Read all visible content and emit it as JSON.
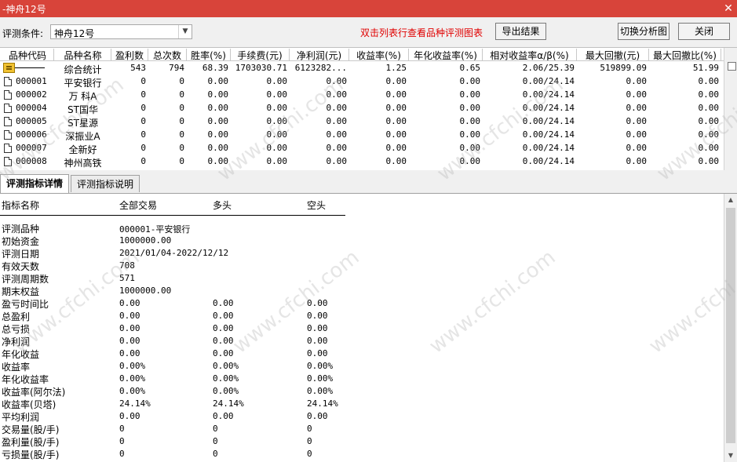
{
  "window": {
    "title": "-神舟12号",
    "close_glyph": "✕"
  },
  "toolbar": {
    "criteria_label": "评测条件:",
    "criteria_value": "神舟12号",
    "hint": "双击列表行查看品种评测图表",
    "export_label": "导出结果",
    "switch_label": "切换分析图",
    "close_label": "关闭"
  },
  "grid": {
    "columns": [
      "品种代码",
      "品种名称",
      "盈利数",
      "总次数",
      "胜率(%)",
      "手续费(元)",
      "净利润(元)",
      "收益率(%)",
      "年化收益率(%)",
      "相对收益率α/β(%)",
      "最大回撤(元)",
      "最大回撤比(%)"
    ],
    "rows": [
      {
        "code": "",
        "name": "综合统计",
        "profit": "543",
        "total": "794",
        "win": "68.39",
        "fee": "1703030.71",
        "net": "6123282...",
        "ret": "1.25",
        "annual": "0.65",
        "rel": "2.06/25.39",
        "mdd": "519899.09",
        "mddr": "51.99"
      },
      {
        "code": "000001",
        "name": "平安银行",
        "profit": "0",
        "total": "0",
        "win": "0.00",
        "fee": "0.00",
        "net": "0.00",
        "ret": "0.00",
        "annual": "0.00",
        "rel": "0.00/24.14",
        "mdd": "0.00",
        "mddr": "0.00"
      },
      {
        "code": "000002",
        "name": "万 科A",
        "profit": "0",
        "total": "0",
        "win": "0.00",
        "fee": "0.00",
        "net": "0.00",
        "ret": "0.00",
        "annual": "0.00",
        "rel": "0.00/24.14",
        "mdd": "0.00",
        "mddr": "0.00"
      },
      {
        "code": "000004",
        "name": "ST国华",
        "profit": "0",
        "total": "0",
        "win": "0.00",
        "fee": "0.00",
        "net": "0.00",
        "ret": "0.00",
        "annual": "0.00",
        "rel": "0.00/24.14",
        "mdd": "0.00",
        "mddr": "0.00"
      },
      {
        "code": "000005",
        "name": "ST星源",
        "profit": "0",
        "total": "0",
        "win": "0.00",
        "fee": "0.00",
        "net": "0.00",
        "ret": "0.00",
        "annual": "0.00",
        "rel": "0.00/24.14",
        "mdd": "0.00",
        "mddr": "0.00"
      },
      {
        "code": "000006",
        "name": "深振业A",
        "profit": "0",
        "total": "0",
        "win": "0.00",
        "fee": "0.00",
        "net": "0.00",
        "ret": "0.00",
        "annual": "0.00",
        "rel": "0.00/24.14",
        "mdd": "0.00",
        "mddr": "0.00"
      },
      {
        "code": "000007",
        "name": "全新好",
        "profit": "0",
        "total": "0",
        "win": "0.00",
        "fee": "0.00",
        "net": "0.00",
        "ret": "0.00",
        "annual": "0.00",
        "rel": "0.00/24.14",
        "mdd": "0.00",
        "mddr": "0.00"
      },
      {
        "code": "000008",
        "name": "神州高铁",
        "profit": "0",
        "total": "0",
        "win": "0.00",
        "fee": "0.00",
        "net": "0.00",
        "ret": "0.00",
        "annual": "0.00",
        "rel": "0.00/24.14",
        "mdd": "0.00",
        "mddr": "0.00"
      }
    ]
  },
  "tabs": [
    "评测指标详情",
    "评测指标说明"
  ],
  "detail": {
    "headers": [
      "指标名称",
      "全部交易",
      "多头",
      "空头"
    ],
    "rows": [
      {
        "label": "评测品种",
        "all": "000001-平安银行",
        "long": "",
        "short": ""
      },
      {
        "label": "初始资金",
        "all": "1000000.00",
        "long": "",
        "short": ""
      },
      {
        "label": "评测日期",
        "all": "2021/01/04-2022/12/12",
        "long": "",
        "short": ""
      },
      {
        "label": "有效天数",
        "all": "708",
        "long": "",
        "short": ""
      },
      {
        "label": "评测周期数",
        "all": "571",
        "long": "",
        "short": ""
      },
      {
        "label": "期末权益",
        "all": "1000000.00",
        "long": "",
        "short": ""
      },
      {
        "label": "盈亏时间比",
        "all": "0.00",
        "long": "0.00",
        "short": "0.00"
      },
      {
        "label": "总盈利",
        "all": "0.00",
        "long": "0.00",
        "short": "0.00"
      },
      {
        "label": "总亏损",
        "all": "0.00",
        "long": "0.00",
        "short": "0.00"
      },
      {
        "label": "净利润",
        "all": "0.00",
        "long": "0.00",
        "short": "0.00"
      },
      {
        "label": "年化收益",
        "all": "0.00",
        "long": "0.00",
        "short": "0.00"
      },
      {
        "label": "收益率",
        "all": "0.00%",
        "long": "0.00%",
        "short": "0.00%"
      },
      {
        "label": "年化收益率",
        "all": "0.00%",
        "long": "0.00%",
        "short": "0.00%"
      },
      {
        "label": "收益率(阿尔法)",
        "all": "0.00%",
        "long": "0.00%",
        "short": "0.00%"
      },
      {
        "label": "收益率(贝塔)",
        "all": "24.14%",
        "long": "24.14%",
        "short": "24.14%"
      },
      {
        "label": "平均利润",
        "all": "0.00",
        "long": "0.00",
        "short": "0.00"
      },
      {
        "label": "交易量(股/手)",
        "all": "0",
        "long": "0",
        "short": "0"
      },
      {
        "label": "盈利量(股/手)",
        "all": "0",
        "long": "0",
        "short": "0"
      },
      {
        "label": "亏损量(股/手)",
        "all": "0",
        "long": "0",
        "short": "0"
      }
    ]
  },
  "watermark": "www.cfchi.com"
}
